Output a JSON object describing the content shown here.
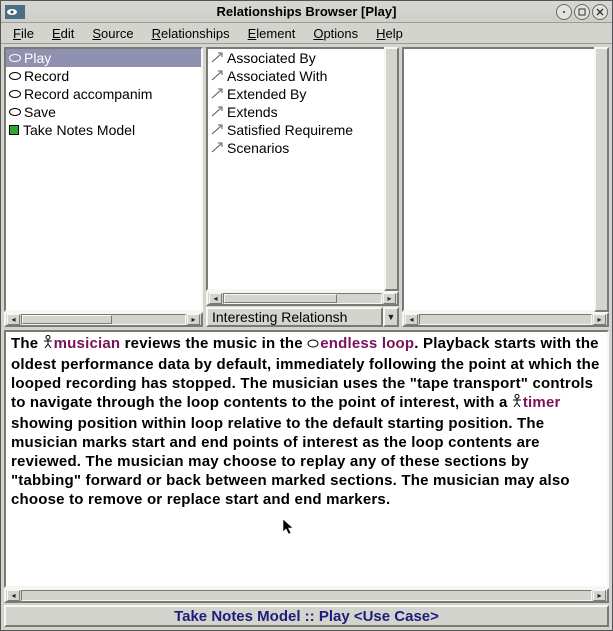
{
  "window": {
    "title": "Relationships Browser [Play]"
  },
  "menubar": [
    "File",
    "Edit",
    "Source",
    "Relationships",
    "Element",
    "Options",
    "Help"
  ],
  "left_list": [
    {
      "icon": "oval",
      "label": "Play",
      "selected": true
    },
    {
      "icon": "oval",
      "label": "Record",
      "selected": false
    },
    {
      "icon": "oval",
      "label": "Record accompanim",
      "selected": false
    },
    {
      "icon": "oval",
      "label": "Save",
      "selected": false
    },
    {
      "icon": "green",
      "label": "Take Notes Model",
      "selected": false
    }
  ],
  "mid_list": [
    "Associated By",
    "Associated With",
    "Extended By",
    "Extends",
    "Satisfied Requireme",
    "Scenarios"
  ],
  "dropdown_label": "Interesting Relationsh",
  "description": {
    "parts": [
      {
        "t": "The "
      },
      {
        "glyph": "actor"
      },
      {
        "t": "musician",
        "link": true
      },
      {
        "t": " reviews the music in the "
      },
      {
        "glyph": "oval"
      },
      {
        "t": "endless loop",
        "link": true
      },
      {
        "t": ".  Playback starts with the oldest performance data by default, immediately following the point at which the looped recording has stopped.  The musician uses the \"tape transport\" controls to navigate through the loop contents to the point of interest, with a "
      },
      {
        "glyph": "actor"
      },
      {
        "t": "timer",
        "link": true
      },
      {
        "t": " showing position within loop relative to the default starting position.  The musician marks start and end points of interest as the loop contents are reviewed.  The musician may choose to replay any of these sections by \"tabbing\" forward or back between marked sections.  The musician may also choose to remove or replace start and end markers."
      }
    ]
  },
  "statusbar": "Take Notes Model :: Play <Use Case>"
}
